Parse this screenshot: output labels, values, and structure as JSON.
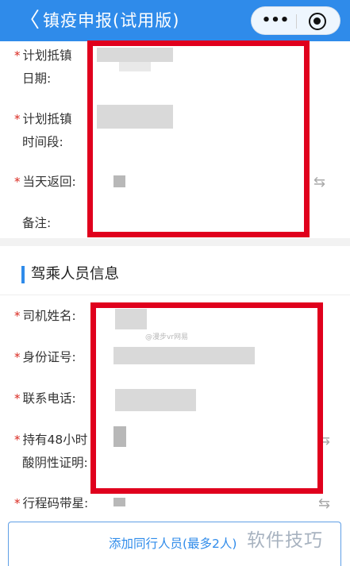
{
  "header": {
    "back_glyph": "〈",
    "title": "镇疫申报(试用版)",
    "more_glyph": "•••"
  },
  "form": {
    "required_mark": "*",
    "plan_date_label_line1": "计划抵镇",
    "plan_date_label_line2": "日期:",
    "plan_time_label_line1": "计划抵镇",
    "plan_time_label_line2": "时间段:",
    "same_day_return_label": "当天返回:",
    "remark_label": "备注:"
  },
  "driver_section": {
    "title": "驾乘人员信息",
    "driver_name_label": "司机姓名:",
    "id_number_label": "身份证号:",
    "phone_label": "联系电话:",
    "test_cert_label_line1": "持有48小时",
    "test_cert_label_line2": "酸阴性证明:",
    "itinerary_code_label": "行程码带星:",
    "watermark_small": "@漫步vr网易"
  },
  "add_companion_button": "添加同行人员(最多2人)",
  "watermark": "软件技巧",
  "colors": {
    "header_bg": "#2f8bea",
    "required_star": "#d9281f",
    "annotation_box": "#e0001d",
    "accent_blue": "#2f8bea"
  }
}
